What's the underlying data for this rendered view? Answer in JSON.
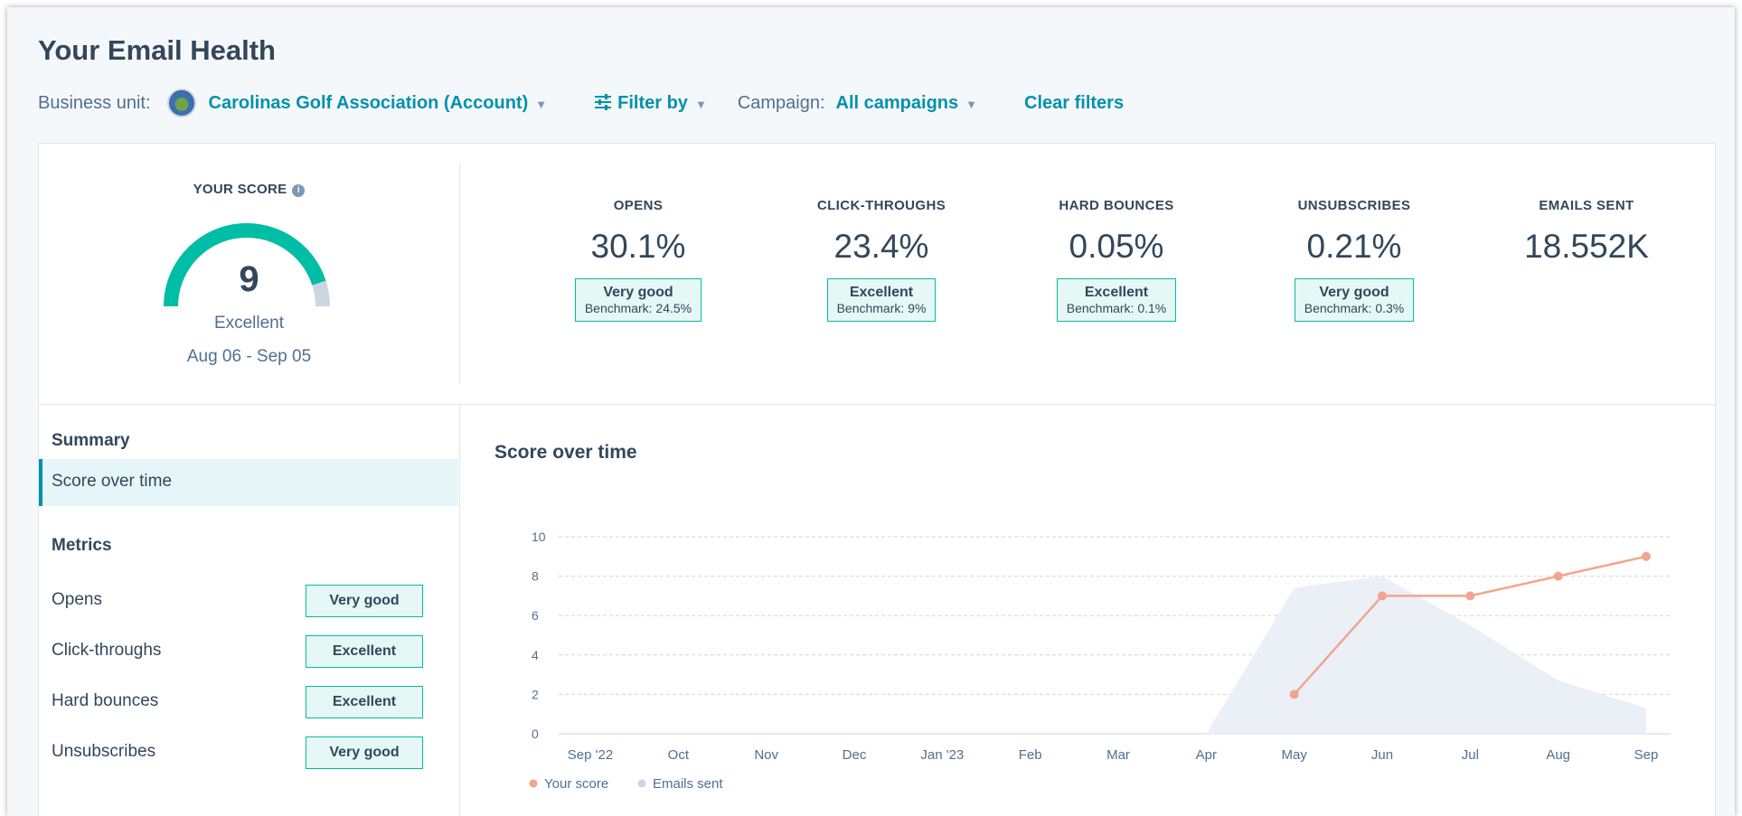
{
  "page": {
    "title": "Your Email Health"
  },
  "filters": {
    "business_unit_label": "Business unit:",
    "business_unit_value": "Carolinas Golf Association (Account)",
    "filter_by_label": "Filter by",
    "campaign_label": "Campaign:",
    "campaign_value": "All campaigns",
    "clear_label": "Clear filters"
  },
  "score": {
    "label": "YOUR SCORE",
    "value": "9",
    "max": 10,
    "rating": "Excellent",
    "range": "Aug 06 - Sep 05"
  },
  "metrics": [
    {
      "label": "OPENS",
      "value": "30.1%",
      "rating": "Very good",
      "benchmark": "Benchmark: 24.5%"
    },
    {
      "label": "CLICK-THROUGHS",
      "value": "23.4%",
      "rating": "Excellent",
      "benchmark": "Benchmark: 9%"
    },
    {
      "label": "HARD BOUNCES",
      "value": "0.05%",
      "rating": "Excellent",
      "benchmark": "Benchmark: 0.1%"
    },
    {
      "label": "UNSUBSCRIBES",
      "value": "0.21%",
      "rating": "Very good",
      "benchmark": "Benchmark: 0.3%"
    },
    {
      "label": "EMAILS SENT",
      "value": "18.552K"
    }
  ],
  "nav": {
    "summary_heading": "Summary",
    "active_item": "Score over time",
    "metrics_heading": "Metrics",
    "items": [
      {
        "label": "Opens",
        "badge": "Very good"
      },
      {
        "label": "Click-throughs",
        "badge": "Excellent"
      },
      {
        "label": "Hard bounces",
        "badge": "Excellent"
      },
      {
        "label": "Unsubscribes",
        "badge": "Very good"
      }
    ]
  },
  "colors": {
    "accent": "#0091ae",
    "badge_border": "#00bda5",
    "score_line": "#f2a58e",
    "emails_area": "#eaf0f6",
    "gauge": "#00bda5"
  },
  "chart_data": {
    "type": "line",
    "title": "Score over time",
    "categories": [
      "Sep '22",
      "Oct",
      "Nov",
      "Dec",
      "Jan '23",
      "Feb",
      "Mar",
      "Apr",
      "May",
      "Jun",
      "Jul",
      "Aug",
      "Sep"
    ],
    "ylim": [
      0,
      10
    ],
    "yticks": [
      0,
      2,
      4,
      6,
      8,
      10
    ],
    "grid": true,
    "legend": "bottom-left",
    "series": [
      {
        "name": "Your score",
        "kind": "line",
        "values": [
          null,
          null,
          null,
          null,
          null,
          null,
          null,
          null,
          2,
          7,
          7,
          8,
          9
        ]
      },
      {
        "name": "Emails sent",
        "kind": "area",
        "values": [
          0,
          0,
          0,
          0,
          0,
          0,
          0,
          0,
          7.4,
          8.0,
          5.5,
          2.7,
          1.3
        ]
      }
    ]
  }
}
